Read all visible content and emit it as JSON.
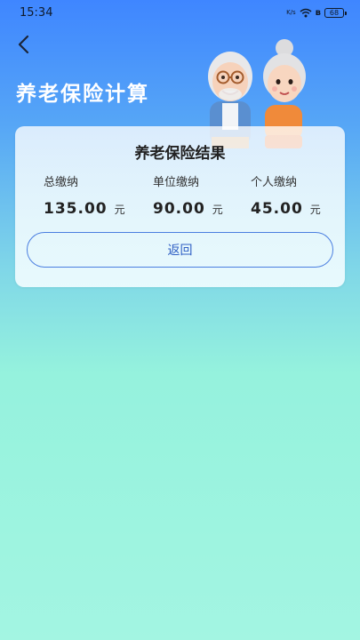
{
  "status_bar": {
    "time": "15:34",
    "network_speed_unit": "K/s",
    "battery": "68"
  },
  "header": {
    "title": "养老保险计算"
  },
  "result_card": {
    "title": "养老保险结果",
    "stats": [
      {
        "label": "总缴纳",
        "value": "135.00",
        "unit": "元"
      },
      {
        "label": "单位缴纳",
        "value": "90.00",
        "unit": "元"
      },
      {
        "label": "个人缴纳",
        "value": "45.00",
        "unit": "元"
      }
    ],
    "return_label": "返回"
  },
  "colors": {
    "header_blue": "#3f86ff",
    "background_mint": "#a3f5e2",
    "button_border": "#4a7ee0"
  },
  "icons": [
    "back-arrow-icon",
    "signal-icon",
    "wifi-icon",
    "bluetooth-icon",
    "battery-icon"
  ]
}
